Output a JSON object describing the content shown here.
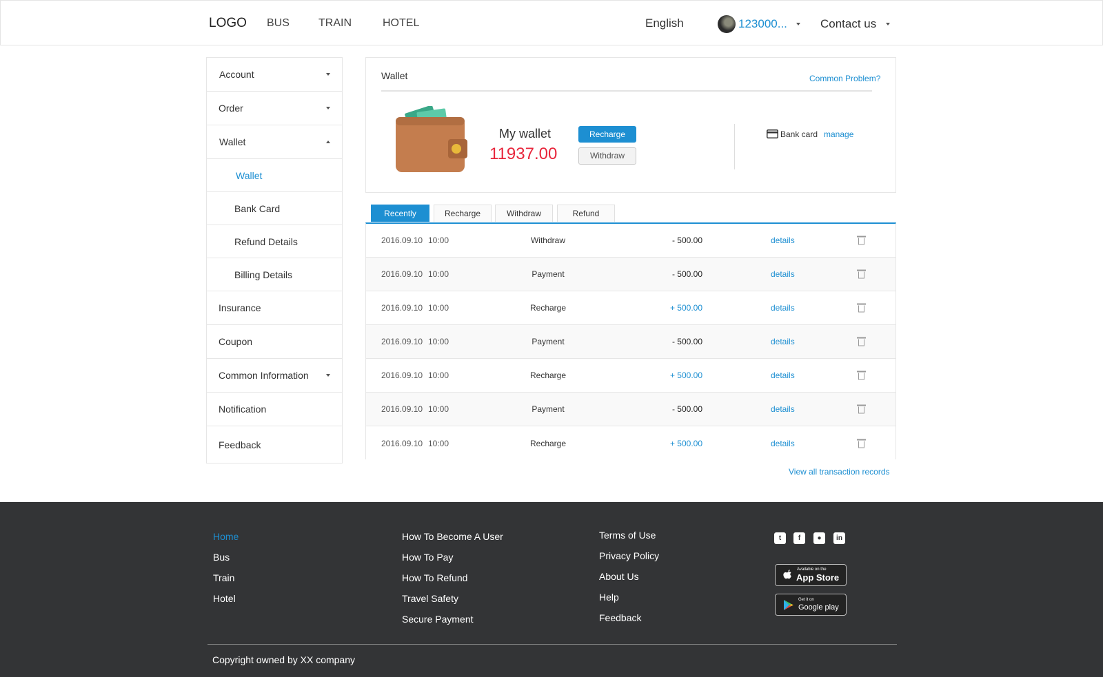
{
  "header": {
    "logo": "LOGO",
    "nav": [
      "BUS",
      "TRAIN",
      "HOTEL"
    ],
    "language": "English",
    "user": "123000...",
    "contact": "Contact us"
  },
  "sidebar": {
    "items": [
      {
        "label": "Account"
      },
      {
        "label": "Order"
      },
      {
        "label": "Wallet"
      },
      {
        "label": "Wallet"
      },
      {
        "label": "Bank Card"
      },
      {
        "label": "Refund Details"
      },
      {
        "label": "Billing Details"
      },
      {
        "label": "Insurance"
      },
      {
        "label": "Coupon"
      },
      {
        "label": "Common Information"
      },
      {
        "label": "Notification"
      },
      {
        "label": "Feedback"
      }
    ]
  },
  "wallet": {
    "title": "Wallet",
    "help_link": "Common Problem?",
    "my_wallet_label": "My wallet",
    "balance": "11937.00",
    "recharge_button": "Recharge",
    "withdraw_button": "Withdraw",
    "bank_card_label": "Bank card",
    "manage_link": "manage"
  },
  "tabs": [
    "Recently",
    "Recharge",
    "Withdraw",
    "Refund"
  ],
  "transactions": [
    {
      "date": "2016.09.10",
      "time": "10:00",
      "type": "Withdraw",
      "amount": "- 500.00",
      "action": "details"
    },
    {
      "date": "2016.09.10",
      "time": "10:00",
      "type": "Payment",
      "amount": "- 500.00",
      "action": "details"
    },
    {
      "date": "2016.09.10",
      "time": "10:00",
      "type": "Recharge",
      "amount": "+ 500.00",
      "action": "details"
    },
    {
      "date": "2016.09.10",
      "time": "10:00",
      "type": "Payment",
      "amount": "- 500.00",
      "action": "details"
    },
    {
      "date": "2016.09.10",
      "time": "10:00",
      "type": "Recharge",
      "amount": "+ 500.00",
      "action": "details"
    },
    {
      "date": "2016.09.10",
      "time": "10:00",
      "type": "Payment",
      "amount": "- 500.00",
      "action": "details"
    },
    {
      "date": "2016.09.10",
      "time": "10:00",
      "type": "Recharge",
      "amount": "+ 500.00",
      "action": "details"
    }
  ],
  "view_all": "View all transaction records",
  "footer": {
    "col1": [
      "Home",
      "Bus",
      "Train",
      "Hotel"
    ],
    "col2": [
      "How To Become A User",
      "How To Pay",
      "How To Refund",
      "Travel Safety",
      "Secure Payment"
    ],
    "col3": [
      "Terms of Use",
      "Privacy Policy",
      "About Us",
      "Help",
      "Feedback"
    ],
    "social_icons": [
      "twitter-icon",
      "facebook-icon",
      "github-icon",
      "linkedin-icon"
    ],
    "app_store": {
      "small": "Available on the",
      "big": "App Store"
    },
    "google_play": {
      "small": "Get it on",
      "big": "Google play"
    },
    "copyright": "Copyright owned by XX company"
  },
  "colors": {
    "accent": "#1d8fd2",
    "balance": "#e8263c",
    "footer_bg": "#333436",
    "wallet_brown": "#c47d4e",
    "cash_green": "#4fc0a0"
  }
}
